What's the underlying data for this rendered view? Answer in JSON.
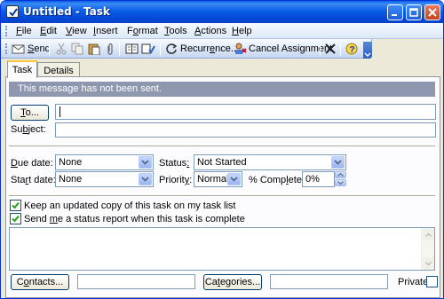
{
  "window": {
    "title": "Untitled - Task",
    "title_icon": "task-checkbox-icon",
    "controls": [
      "minimize-icon",
      "maximize-icon",
      "close-icon"
    ]
  },
  "menu": {
    "items": [
      {
        "pre": "",
        "key": "F",
        "post": "ile"
      },
      {
        "pre": "",
        "key": "E",
        "post": "dit"
      },
      {
        "pre": "",
        "key": "V",
        "post": "iew"
      },
      {
        "pre": "",
        "key": "I",
        "post": "nsert"
      },
      {
        "pre": "F",
        "key": "o",
        "post": "rmat"
      },
      {
        "pre": "",
        "key": "T",
        "post": "ools"
      },
      {
        "pre": "",
        "key": "A",
        "post": "ctions"
      },
      {
        "pre": "",
        "key": "H",
        "post": "elp"
      }
    ]
  },
  "toolbar": {
    "send_label_key": "S",
    "send_label_rest": "end",
    "recurrence_label_pre": "Recurr",
    "recurrence_label_key": "e",
    "recurrence_label_post": "nce...",
    "cancel_assignment_label": "Cancel Assignment",
    "icons": [
      "send-icon",
      "cut-icon",
      "copy-icon",
      "paste-icon",
      "attach-icon",
      "address-book-icon",
      "check-names-icon",
      "recurrence-icon",
      "cancel-assignment-icon",
      "delete-icon",
      "help-icon"
    ]
  },
  "tabs": [
    {
      "label": "Task",
      "active": true
    },
    {
      "label": "Details",
      "active": false
    }
  ],
  "infobar": {
    "text": "This message has not been sent."
  },
  "form": {
    "to_button_key": "T",
    "to_button_rest": "o...",
    "to_value": "",
    "subject_label_pre": "Su",
    "subject_label_key": "b",
    "subject_label_post": "ject:",
    "subject_value": "",
    "due_date_label_key": "D",
    "due_date_label_rest": "ue date:",
    "due_date_value": "None",
    "start_date_label_pre": "Sta",
    "start_date_label_key": "r",
    "start_date_label_post": "t date:",
    "start_date_value": "None",
    "status_label_pre": "Status",
    "status_label_key": ":",
    "status_value": "Not Started",
    "priority_label_pre": "Priorit",
    "priority_label_key": "y",
    "priority_label_post": ":",
    "priority_value": "Normal",
    "complete_label_pre": "% Comp",
    "complete_label_key": "l",
    "complete_label_post": "ete:",
    "complete_value": "0%",
    "keep_copy_label": "Keep an updated copy of this task on my task list",
    "keep_copy_checked": true,
    "status_report_label_pre": "Send ",
    "status_report_label_key": "m",
    "status_report_label_post": "e a status report when this task is complete",
    "status_report_checked": true,
    "notes_value": ""
  },
  "footer": {
    "contacts_button_pre": "C",
    "contacts_button_key": "o",
    "contacts_button_post": "ntacts...",
    "contacts_value": "",
    "categories_button_pre": "Ca",
    "categories_button_key": "t",
    "categories_button_post": "egories...",
    "categories_value": "",
    "private_label": "Private",
    "private_checked": false
  },
  "colors": {
    "titlebar": "#0a5ee6",
    "infobar": "#8e97ae",
    "window_bg": "#ece9d8",
    "active_tab_accent": "#ffc83c"
  }
}
